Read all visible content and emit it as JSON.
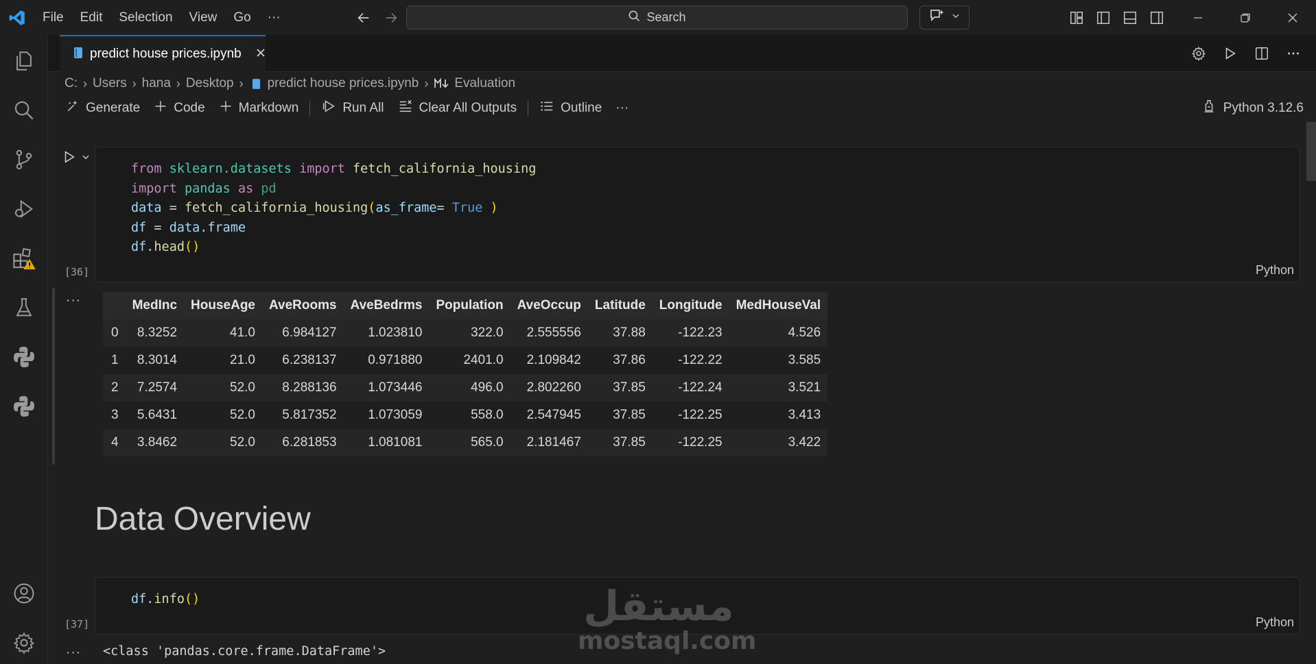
{
  "titlebar": {
    "menu": [
      "File",
      "Edit",
      "Selection",
      "View",
      "Go",
      "···"
    ],
    "search_placeholder": "Search"
  },
  "tab": {
    "label": "predict house prices.ipynb"
  },
  "breadcrumb": {
    "items": [
      "C:",
      "Users",
      "hana",
      "Desktop",
      "predict house prices.ipynb"
    ],
    "section_label": "Evaluation"
  },
  "toolbar": {
    "generate": "Generate",
    "code": "Code",
    "markdown": "Markdown",
    "run_all": "Run All",
    "clear_outputs": "Clear All Outputs",
    "outline": "Outline",
    "more": "···",
    "kernel": "Python 3.12.6"
  },
  "cell1": {
    "exec_count": "[36]",
    "language": "Python",
    "code": [
      [
        [
          "kw",
          "from"
        ],
        [
          "t",
          " "
        ],
        [
          "mod",
          "sklearn.datasets"
        ],
        [
          "t",
          " "
        ],
        [
          "kw",
          "import"
        ],
        [
          "t",
          " "
        ],
        [
          "fn",
          "fetch_california_housing"
        ]
      ],
      [
        [
          "kw",
          "import"
        ],
        [
          "t",
          " "
        ],
        [
          "mod",
          "pandas"
        ],
        [
          "t",
          " "
        ],
        [
          "kw",
          "as"
        ],
        [
          "t",
          " "
        ],
        [
          "pdmuted",
          "pd"
        ]
      ],
      [
        [
          "var",
          "data"
        ],
        [
          "t",
          " = "
        ],
        [
          "fn",
          "fetch_california_housing"
        ],
        [
          "paren",
          "("
        ],
        [
          "var",
          "as_frame"
        ],
        [
          "t",
          "= "
        ],
        [
          "bool",
          "True"
        ],
        [
          "t",
          " "
        ],
        [
          "paren",
          ")"
        ]
      ],
      [
        [
          "var",
          "df"
        ],
        [
          "t",
          " = "
        ],
        [
          "var",
          "data"
        ],
        [
          "t",
          "."
        ],
        [
          "var",
          "frame"
        ]
      ],
      [
        [
          "var",
          "df"
        ],
        [
          "t",
          "."
        ],
        [
          "fn",
          "head"
        ],
        [
          "paren",
          "()"
        ]
      ]
    ]
  },
  "output1": {
    "dots": "···",
    "table": {
      "columns": [
        "",
        "MedInc",
        "HouseAge",
        "AveRooms",
        "AveBedrms",
        "Population",
        "AveOccup",
        "Latitude",
        "Longitude",
        "MedHouseVal"
      ],
      "rows": [
        [
          "0",
          "8.3252",
          "41.0",
          "6.984127",
          "1.023810",
          "322.0",
          "2.555556",
          "37.88",
          "-122.23",
          "4.526"
        ],
        [
          "1",
          "8.3014",
          "21.0",
          "6.238137",
          "0.971880",
          "2401.0",
          "2.109842",
          "37.86",
          "-122.22",
          "3.585"
        ],
        [
          "2",
          "7.2574",
          "52.0",
          "8.288136",
          "1.073446",
          "496.0",
          "2.802260",
          "37.85",
          "-122.24",
          "3.521"
        ],
        [
          "3",
          "5.6431",
          "52.0",
          "5.817352",
          "1.073059",
          "558.0",
          "2.547945",
          "37.85",
          "-122.25",
          "3.413"
        ],
        [
          "4",
          "3.8462",
          "52.0",
          "6.281853",
          "1.081081",
          "565.0",
          "2.181467",
          "37.85",
          "-122.25",
          "3.422"
        ]
      ]
    }
  },
  "markdown_heading": "Data Overview",
  "cell2": {
    "exec_count": "[37]",
    "language": "Python",
    "code": [
      [
        [
          "var",
          "df"
        ],
        [
          "t",
          "."
        ],
        [
          "fn",
          "info"
        ],
        [
          "paren",
          "()"
        ]
      ]
    ]
  },
  "output2": {
    "dots": "···",
    "text": "<class 'pandas.core.frame.DataFrame'>"
  },
  "watermark": {
    "logo": "مستقل",
    "text": "mostaql.com"
  },
  "colors": {
    "accent": "#0078d4",
    "background": "#1f1f1f",
    "warning": "#e5a50a"
  },
  "icons": [
    "vscode-logo-icon",
    "arrow-left-icon",
    "arrow-right-icon",
    "search-icon",
    "copilot-icon",
    "chevron-down-icon",
    "layout-icon",
    "sidebar-left-icon",
    "panel-icon",
    "sidebar-right-icon",
    "minimize-icon",
    "restore-icon",
    "close-icon",
    "explorer-icon",
    "search-icon",
    "source-control-icon",
    "run-debug-icon",
    "extensions-icon",
    "testing-icon",
    "python-icon",
    "account-icon",
    "gear-icon",
    "notebook-icon",
    "markdown-icon",
    "sparkle-icon",
    "plus-icon",
    "run-all-icon",
    "clear-outputs-icon",
    "outline-icon",
    "kernel-icon",
    "run-cell-icon"
  ]
}
